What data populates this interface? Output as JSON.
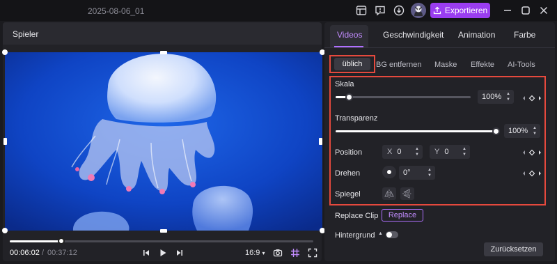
{
  "window": {
    "title": "2025-08-06_01",
    "export_label": "Exportieren",
    "accent": "#9a3df0"
  },
  "player": {
    "title": "Spieler",
    "current_time": "00:06:02",
    "separator": "/",
    "total_time": "00:37:12",
    "aspect_ratio": "16:9",
    "progress": 0.17
  },
  "panel": {
    "tabs": [
      "Videos",
      "Geschwindigkeit",
      "Animation",
      "Farbe"
    ],
    "subtabs": [
      "üblich",
      "BG entfernen",
      "Maske",
      "Effekte",
      "AI-Tools"
    ],
    "scale": {
      "label": "Skala",
      "value": "100%",
      "level": 0.1
    },
    "transparency": {
      "label": "Transparenz",
      "value": "100%",
      "level": 1.0
    },
    "position": {
      "label": "Position",
      "x_label": "X",
      "x_value": "0",
      "y_label": "Y",
      "y_value": "0"
    },
    "rotate": {
      "label": "Drehen",
      "value": "0°"
    },
    "mirror": {
      "label": "Spiegel"
    },
    "replace_clip": {
      "label": "Replace Clip",
      "button": "Replace"
    },
    "background": {
      "label": "Hintergrund"
    },
    "reset_label": "Zurücksetzen"
  },
  "icons": {
    "layout": "layout-icon",
    "feedback": "feedback-icon",
    "download": "download-icon",
    "upload": "upload-icon",
    "minimize": "minimize-icon",
    "maximize": "maximize-icon",
    "close": "close-icon"
  },
  "colors": {
    "highlight_box": "#e5493d",
    "active_tab": "#c28cff"
  }
}
